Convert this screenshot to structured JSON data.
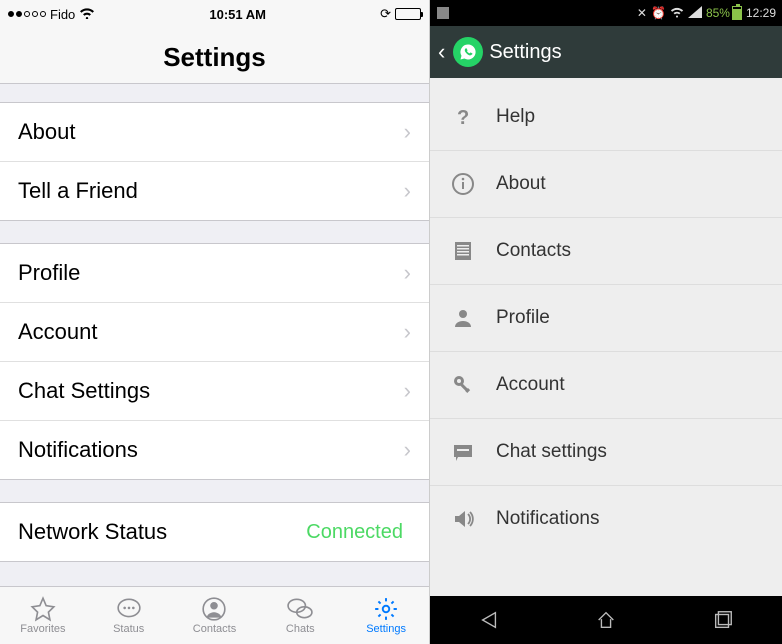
{
  "ios": {
    "statusbar": {
      "carrier": "Fido",
      "time": "10:51 AM"
    },
    "header": "Settings",
    "sections": [
      {
        "rows": [
          {
            "label": "About"
          },
          {
            "label": "Tell a Friend"
          }
        ]
      },
      {
        "rows": [
          {
            "label": "Profile"
          },
          {
            "label": "Account"
          },
          {
            "label": "Chat Settings"
          },
          {
            "label": "Notifications"
          }
        ]
      },
      {
        "rows": [
          {
            "label": "Network Status",
            "value": "Connected",
            "no_chevron": true
          }
        ]
      }
    ],
    "tabs": [
      {
        "label": "Favorites"
      },
      {
        "label": "Status"
      },
      {
        "label": "Contacts"
      },
      {
        "label": "Chats"
      },
      {
        "label": "Settings"
      }
    ]
  },
  "android": {
    "statusbar": {
      "battery": "85%",
      "time": "12:29"
    },
    "header": "Settings",
    "rows": [
      {
        "icon": "help",
        "label": "Help"
      },
      {
        "icon": "info",
        "label": "About"
      },
      {
        "icon": "contacts",
        "label": "Contacts"
      },
      {
        "icon": "profile",
        "label": "Profile"
      },
      {
        "icon": "key",
        "label": "Account"
      },
      {
        "icon": "chat",
        "label": "Chat settings"
      },
      {
        "icon": "sound",
        "label": "Notifications"
      }
    ]
  }
}
